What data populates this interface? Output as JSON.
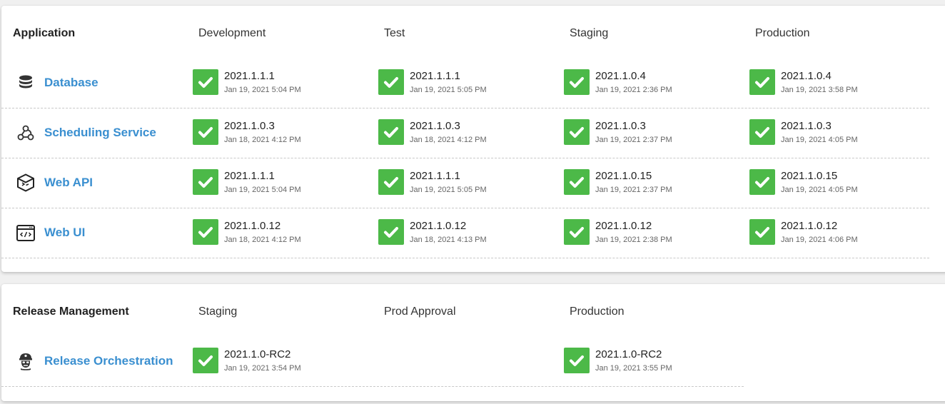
{
  "applications": {
    "header": "Application",
    "environments": [
      "Development",
      "Test",
      "Staging",
      "Production"
    ],
    "rows": [
      {
        "name": "Database",
        "icon": "database-icon",
        "deployments": [
          {
            "version": "2021.1.1.1",
            "date": "Jan 19, 2021 5:04 PM"
          },
          {
            "version": "2021.1.1.1",
            "date": "Jan 19, 2021 5:05 PM"
          },
          {
            "version": "2021.1.0.4",
            "date": "Jan 19, 2021 2:36 PM"
          },
          {
            "version": "2021.1.0.4",
            "date": "Jan 19, 2021 3:58 PM"
          }
        ]
      },
      {
        "name": "Scheduling Service",
        "icon": "webhook-icon",
        "deployments": [
          {
            "version": "2021.1.0.3",
            "date": "Jan 18, 2021 4:12 PM"
          },
          {
            "version": "2021.1.0.3",
            "date": "Jan 18, 2021 4:12 PM"
          },
          {
            "version": "2021.1.0.3",
            "date": "Jan 19, 2021 2:37 PM"
          },
          {
            "version": "2021.1.0.3",
            "date": "Jan 19, 2021 4:05 PM"
          }
        ]
      },
      {
        "name": "Web API",
        "icon": "cube-icon",
        "deployments": [
          {
            "version": "2021.1.1.1",
            "date": "Jan 19, 2021 5:04 PM"
          },
          {
            "version": "2021.1.1.1",
            "date": "Jan 19, 2021 5:05 PM"
          },
          {
            "version": "2021.1.0.15",
            "date": "Jan 19, 2021 2:37 PM"
          },
          {
            "version": "2021.1.0.15",
            "date": "Jan 19, 2021 4:05 PM"
          }
        ]
      },
      {
        "name": "Web UI",
        "icon": "code-window-icon",
        "deployments": [
          {
            "version": "2021.1.0.12",
            "date": "Jan 18, 2021 4:12 PM"
          },
          {
            "version": "2021.1.0.12",
            "date": "Jan 18, 2021 4:13 PM"
          },
          {
            "version": "2021.1.0.12",
            "date": "Jan 19, 2021 2:38 PM"
          },
          {
            "version": "2021.1.0.12",
            "date": "Jan 19, 2021 4:06 PM"
          }
        ]
      }
    ]
  },
  "release_management": {
    "header": "Release Management",
    "environments": [
      "Staging",
      "Prod Approval",
      "Production"
    ],
    "rows": [
      {
        "name": "Release Orchestration",
        "icon": "conductor-icon",
        "deployments": [
          {
            "version": "2021.1.0-RC2",
            "date": "Jan 19, 2021 3:54 PM"
          },
          null,
          {
            "version": "2021.1.0-RC2",
            "date": "Jan 19, 2021 3:55 PM"
          }
        ]
      }
    ]
  },
  "colors": {
    "success": "#4cb948",
    "link": "#3a8fd0"
  }
}
